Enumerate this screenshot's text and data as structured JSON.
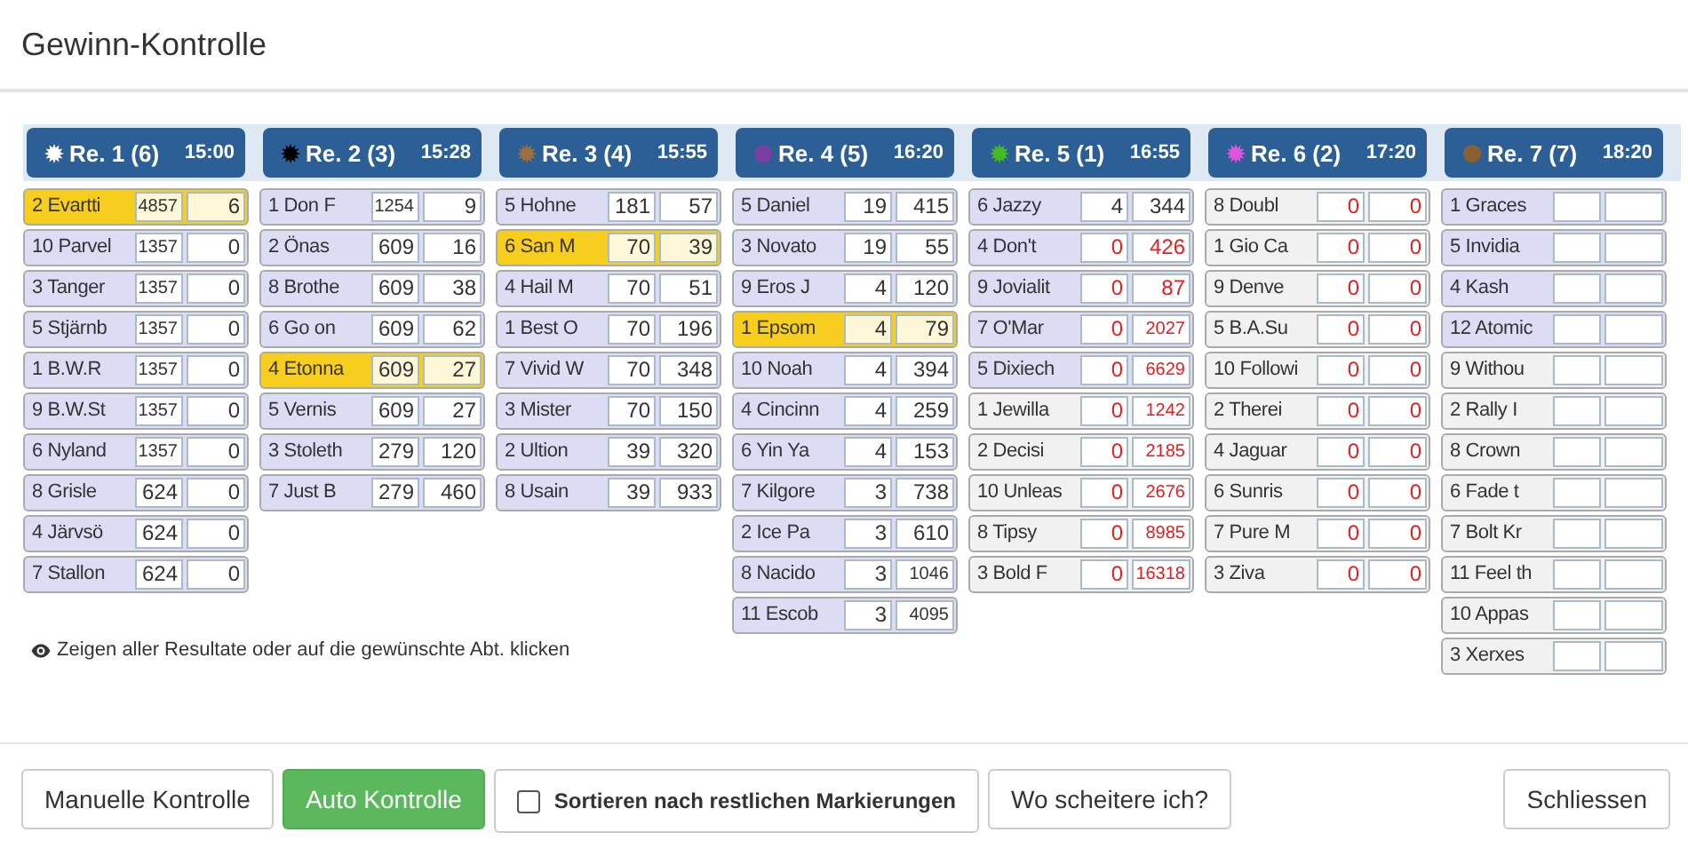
{
  "dialog": {
    "title": "Gewinn-Kontrolle"
  },
  "races": [
    {
      "label": "Re. 1 (6)",
      "time": "15:00",
      "kind": "star",
      "color": "#ffffff",
      "rows": [
        {
          "name": "2 Evartti",
          "points": "4857",
          "payout": "6",
          "kind": "winner",
          "red": false
        },
        {
          "name": "10 Parvel",
          "points": "1357",
          "payout": "0",
          "kind": "marked",
          "red": false
        },
        {
          "name": "3 Tanger",
          "points": "1357",
          "payout": "0",
          "kind": "marked",
          "red": false
        },
        {
          "name": "5 Stjärnb",
          "points": "1357",
          "payout": "0",
          "kind": "marked",
          "red": false
        },
        {
          "name": "1 B.W.R",
          "points": "1357",
          "payout": "0",
          "kind": "marked",
          "red": false
        },
        {
          "name": "9 B.W.St",
          "points": "1357",
          "payout": "0",
          "kind": "marked",
          "red": false
        },
        {
          "name": "6 Nyland",
          "points": "1357",
          "payout": "0",
          "kind": "marked",
          "red": false
        },
        {
          "name": "8 Grisle",
          "points": "624",
          "payout": "0",
          "kind": "marked",
          "red": false
        },
        {
          "name": "4 Järvsö",
          "points": "624",
          "payout": "0",
          "kind": "marked",
          "red": false
        },
        {
          "name": "7 Stallon",
          "points": "624",
          "payout": "0",
          "kind": "marked",
          "red": false
        }
      ]
    },
    {
      "label": "Re. 2 (3)",
      "time": "15:28",
      "kind": "star",
      "color": "#000000",
      "rows": [
        {
          "name": "1 Don F",
          "points": "1254",
          "payout": "9",
          "kind": "marked",
          "red": false
        },
        {
          "name": "2 Önas",
          "points": "609",
          "payout": "16",
          "kind": "marked",
          "red": false
        },
        {
          "name": "8 Brothe",
          "points": "609",
          "payout": "38",
          "kind": "marked",
          "red": false
        },
        {
          "name": "6 Go on",
          "points": "609",
          "payout": "62",
          "kind": "marked",
          "red": false
        },
        {
          "name": "4 Etonna",
          "points": "609",
          "payout": "27",
          "kind": "winner",
          "red": false
        },
        {
          "name": "5 Vernis",
          "points": "609",
          "payout": "27",
          "kind": "marked",
          "red": false
        },
        {
          "name": "3 Stoleth",
          "points": "279",
          "payout": "120",
          "kind": "marked",
          "red": false
        },
        {
          "name": "7 Just B",
          "points": "279",
          "payout": "460",
          "kind": "marked",
          "red": false
        }
      ]
    },
    {
      "label": "Re. 3 (4)",
      "time": "15:55",
      "kind": "star",
      "color": "#9a7040",
      "rows": [
        {
          "name": "5 Hohne",
          "points": "181",
          "payout": "57",
          "kind": "marked",
          "red": false
        },
        {
          "name": "6 San M",
          "points": "70",
          "payout": "39",
          "kind": "winner",
          "red": false
        },
        {
          "name": "4 Hail M",
          "points": "70",
          "payout": "51",
          "kind": "marked",
          "red": false
        },
        {
          "name": "1 Best O",
          "points": "70",
          "payout": "196",
          "kind": "marked",
          "red": false
        },
        {
          "name": "7 Vivid W",
          "points": "70",
          "payout": "348",
          "kind": "marked",
          "red": false
        },
        {
          "name": "3 Mister",
          "points": "70",
          "payout": "150",
          "kind": "marked",
          "red": false
        },
        {
          "name": "2 Ultion",
          "points": "39",
          "payout": "320",
          "kind": "marked",
          "red": false
        },
        {
          "name": "8 Usain",
          "points": "39",
          "payout": "933",
          "kind": "marked",
          "red": false
        }
      ]
    },
    {
      "label": "Re. 4 (5)",
      "time": "16:20",
      "kind": "dot",
      "color": "#7a3fa0",
      "rows": [
        {
          "name": "5 Daniel",
          "points": "19",
          "payout": "415",
          "kind": "marked",
          "red": false
        },
        {
          "name": "3 Novato",
          "points": "19",
          "payout": "55",
          "kind": "marked",
          "red": false
        },
        {
          "name": "9 Eros J",
          "points": "4",
          "payout": "120",
          "kind": "marked",
          "red": false
        },
        {
          "name": "1 Epsom",
          "points": "4",
          "payout": "79",
          "kind": "winner",
          "red": false
        },
        {
          "name": "10 Noah",
          "points": "4",
          "payout": "394",
          "kind": "marked",
          "red": false
        },
        {
          "name": "4 Cincinn",
          "points": "4",
          "payout": "259",
          "kind": "marked",
          "red": false
        },
        {
          "name": "6 Yin Ya",
          "points": "4",
          "payout": "153",
          "kind": "marked",
          "red": false
        },
        {
          "name": "7 Kilgore",
          "points": "3",
          "payout": "738",
          "kind": "marked",
          "red": false
        },
        {
          "name": "2 Ice Pa",
          "points": "3",
          "payout": "610",
          "kind": "marked",
          "red": false
        },
        {
          "name": "8 Nacido",
          "points": "3",
          "payout": "1046",
          "kind": "marked",
          "red": false
        },
        {
          "name": "11 Escob",
          "points": "3",
          "payout": "4095",
          "kind": "marked",
          "red": false
        }
      ]
    },
    {
      "label": "Re. 5 (1)",
      "time": "16:55",
      "kind": "star",
      "color": "#44bb22",
      "rows": [
        {
          "name": "6 Jazzy",
          "points": "4",
          "payout": "344",
          "kind": "marked",
          "red": false
        },
        {
          "name": "4 Don't",
          "points": "0",
          "payout": "426",
          "kind": "marked",
          "red": true
        },
        {
          "name": "9 Jovialit",
          "points": "0",
          "payout": "87",
          "kind": "marked",
          "red": true
        },
        {
          "name": "7 O'Mar",
          "points": "0",
          "payout": "2027",
          "kind": "marked",
          "red": true
        },
        {
          "name": "5 Dixiech",
          "points": "0",
          "payout": "6629",
          "kind": "marked",
          "red": true
        },
        {
          "name": "1 Jewilla",
          "points": "0",
          "payout": "1242",
          "kind": "plain",
          "red": true
        },
        {
          "name": "2 Decisi",
          "points": "0",
          "payout": "2185",
          "kind": "plain",
          "red": true
        },
        {
          "name": "10 Unleas",
          "points": "0",
          "payout": "2676",
          "kind": "plain",
          "red": true
        },
        {
          "name": "8 Tipsy",
          "points": "0",
          "payout": "8985",
          "kind": "plain",
          "red": true
        },
        {
          "name": "3 Bold F",
          "points": "0",
          "payout": "16318",
          "kind": "plain",
          "red": true
        }
      ]
    },
    {
      "label": "Re. 6 (2)",
      "time": "17:20",
      "kind": "star",
      "color": "#dd55dd",
      "rows": [
        {
          "name": "8 Doubl",
          "points": "0",
          "payout": "0",
          "kind": "plain",
          "red": true
        },
        {
          "name": "1 Gio Ca",
          "points": "0",
          "payout": "0",
          "kind": "plain",
          "red": true
        },
        {
          "name": "9 Denve",
          "points": "0",
          "payout": "0",
          "kind": "plain",
          "red": true
        },
        {
          "name": "5 B.A.Su",
          "points": "0",
          "payout": "0",
          "kind": "plain",
          "red": true
        },
        {
          "name": "10 Followi",
          "points": "0",
          "payout": "0",
          "kind": "plain",
          "red": true
        },
        {
          "name": "2 Therei",
          "points": "0",
          "payout": "0",
          "kind": "plain",
          "red": true
        },
        {
          "name": "4 Jaguar",
          "points": "0",
          "payout": "0",
          "kind": "plain",
          "red": true
        },
        {
          "name": "6 Sunris",
          "points": "0",
          "payout": "0",
          "kind": "plain",
          "red": true
        },
        {
          "name": "7 Pure M",
          "points": "0",
          "payout": "0",
          "kind": "plain",
          "red": true
        },
        {
          "name": "3 Ziva",
          "points": "0",
          "payout": "0",
          "kind": "plain",
          "red": true
        }
      ]
    },
    {
      "label": "Re. 7 (7)",
      "time": "18:20",
      "kind": "dot",
      "color": "#8a6030",
      "rows": [
        {
          "name": "1 Graces",
          "kind": "marked"
        },
        {
          "name": "5 Invidia",
          "kind": "marked"
        },
        {
          "name": "4 Kash",
          "kind": "marked"
        },
        {
          "name": "12 Atomic",
          "kind": "marked"
        },
        {
          "name": "9 Withou",
          "kind": "plain"
        },
        {
          "name": "2 Rally I",
          "kind": "plain"
        },
        {
          "name": "8 Crown",
          "kind": "plain"
        },
        {
          "name": "6 Fade t",
          "kind": "plain"
        },
        {
          "name": "7 Bolt Kr",
          "kind": "plain"
        },
        {
          "name": "11 Feel th",
          "kind": "plain"
        },
        {
          "name": "10 Appas",
          "kind": "plain"
        },
        {
          "name": "3 Xerxes",
          "kind": "plain"
        }
      ]
    }
  ],
  "hint": "Zeigen aller Resultate oder auf die gewünschte Abt. klicken",
  "buttons": [
    {
      "label": "Manuelle Kontrolle",
      "kind": "default"
    },
    {
      "label": "Auto Kontrolle",
      "kind": "primary"
    },
    {
      "label": "Sortieren nach restlichen Markierungen",
      "kind": "checkbox",
      "checked": false
    },
    {
      "label": "Wo scheitere ich?",
      "kind": "default"
    }
  ],
  "close_button": "Schliessen"
}
